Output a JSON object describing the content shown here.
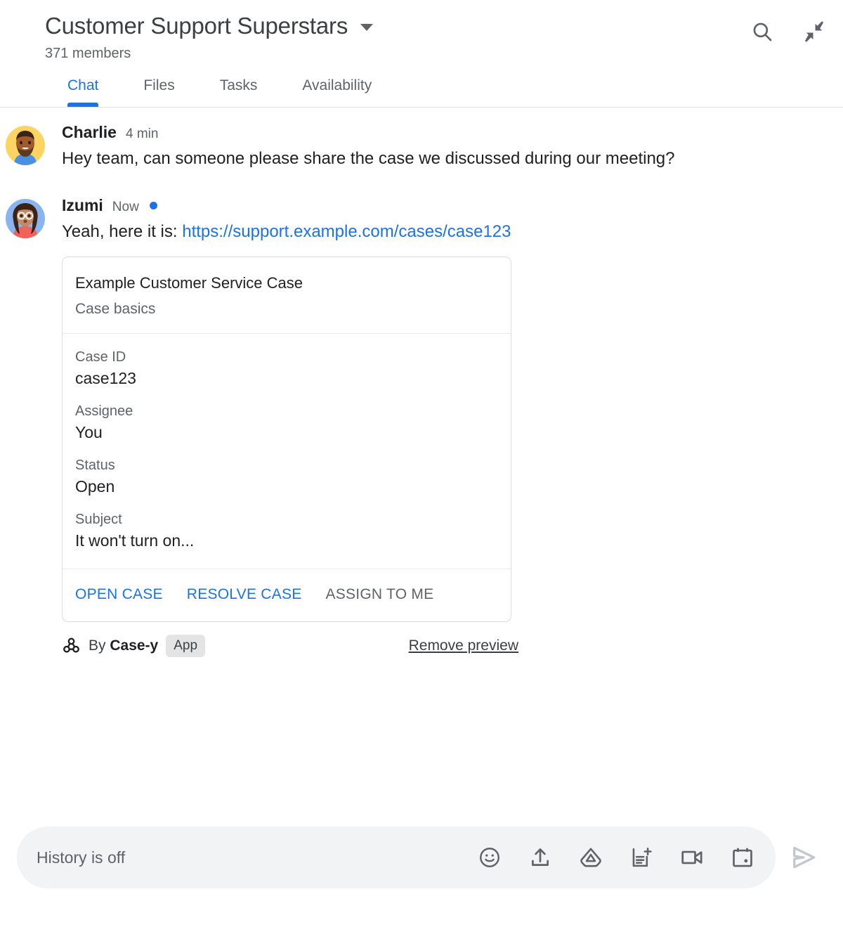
{
  "header": {
    "title": "Customer Support Superstars",
    "members": "371 members",
    "dropdown_icon": "chevron-down-icon",
    "search_icon": "search-icon",
    "collapse_icon": "collapse-icon"
  },
  "tabs": [
    {
      "label": "Chat",
      "active": true
    },
    {
      "label": "Files",
      "active": false
    },
    {
      "label": "Tasks",
      "active": false
    },
    {
      "label": "Availability",
      "active": false
    }
  ],
  "messages": [
    {
      "sender": "Charlie",
      "time": "4 min",
      "unread": false,
      "text": "Hey team, can someone please share the case we discussed during our meeting?"
    },
    {
      "sender": "Izumi",
      "time": "Now",
      "unread": true,
      "text_prefix": "Yeah, here it is: ",
      "link": "https://support.example.com/cases/case123"
    }
  ],
  "card": {
    "title": "Example Customer Service Case",
    "subtitle": "Case basics",
    "fields": [
      {
        "label": "Case ID",
        "value": "case123"
      },
      {
        "label": "Assignee",
        "value": "You"
      },
      {
        "label": "Status",
        "value": "Open"
      },
      {
        "label": "Subject",
        "value": "It won't turn on..."
      }
    ],
    "actions": [
      {
        "label": "OPEN CASE",
        "style": "primary"
      },
      {
        "label": "RESOLVE CASE",
        "style": "primary"
      },
      {
        "label": "ASSIGN TO ME",
        "style": "muted"
      }
    ]
  },
  "attribution": {
    "icon": "webhook-icon",
    "by_prefix": "By ",
    "app_name": "Case-y",
    "badge": "App",
    "remove_label": "Remove preview"
  },
  "compose": {
    "placeholder": "History is off",
    "icons": [
      "emoji-icon",
      "upload-icon",
      "google-drive-icon",
      "add-document-icon",
      "video-camera-icon",
      "calendar-icon"
    ],
    "send_icon": "send-icon"
  },
  "colors": {
    "accent": "#1a73e8",
    "text_primary": "#202124",
    "text_secondary": "#5f6368",
    "compose_bg": "#f1f3f4",
    "border": "#dadce0"
  }
}
